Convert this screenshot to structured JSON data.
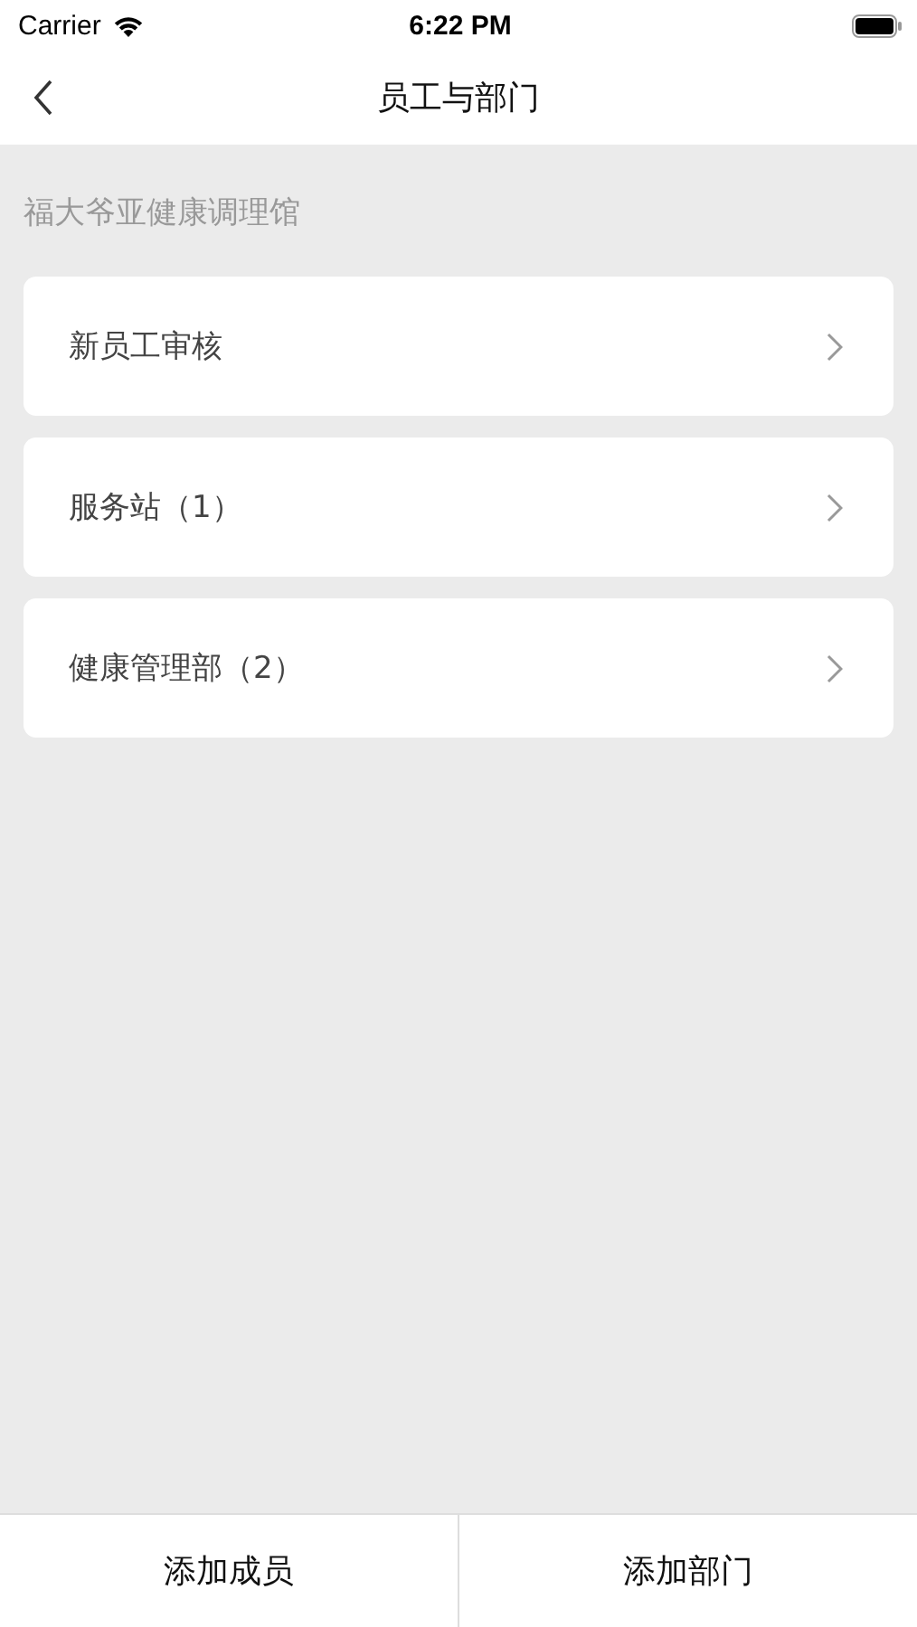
{
  "status_bar": {
    "carrier": "Carrier",
    "time": "6:22 PM"
  },
  "nav": {
    "title": "员工与部门"
  },
  "organization": "福大爷亚健康调理馆",
  "items": [
    {
      "label": "新员工审核"
    },
    {
      "label": "服务站（1）"
    },
    {
      "label": "健康管理部（2）"
    }
  ],
  "buttons": [
    "添加成员",
    "添加部门"
  ]
}
